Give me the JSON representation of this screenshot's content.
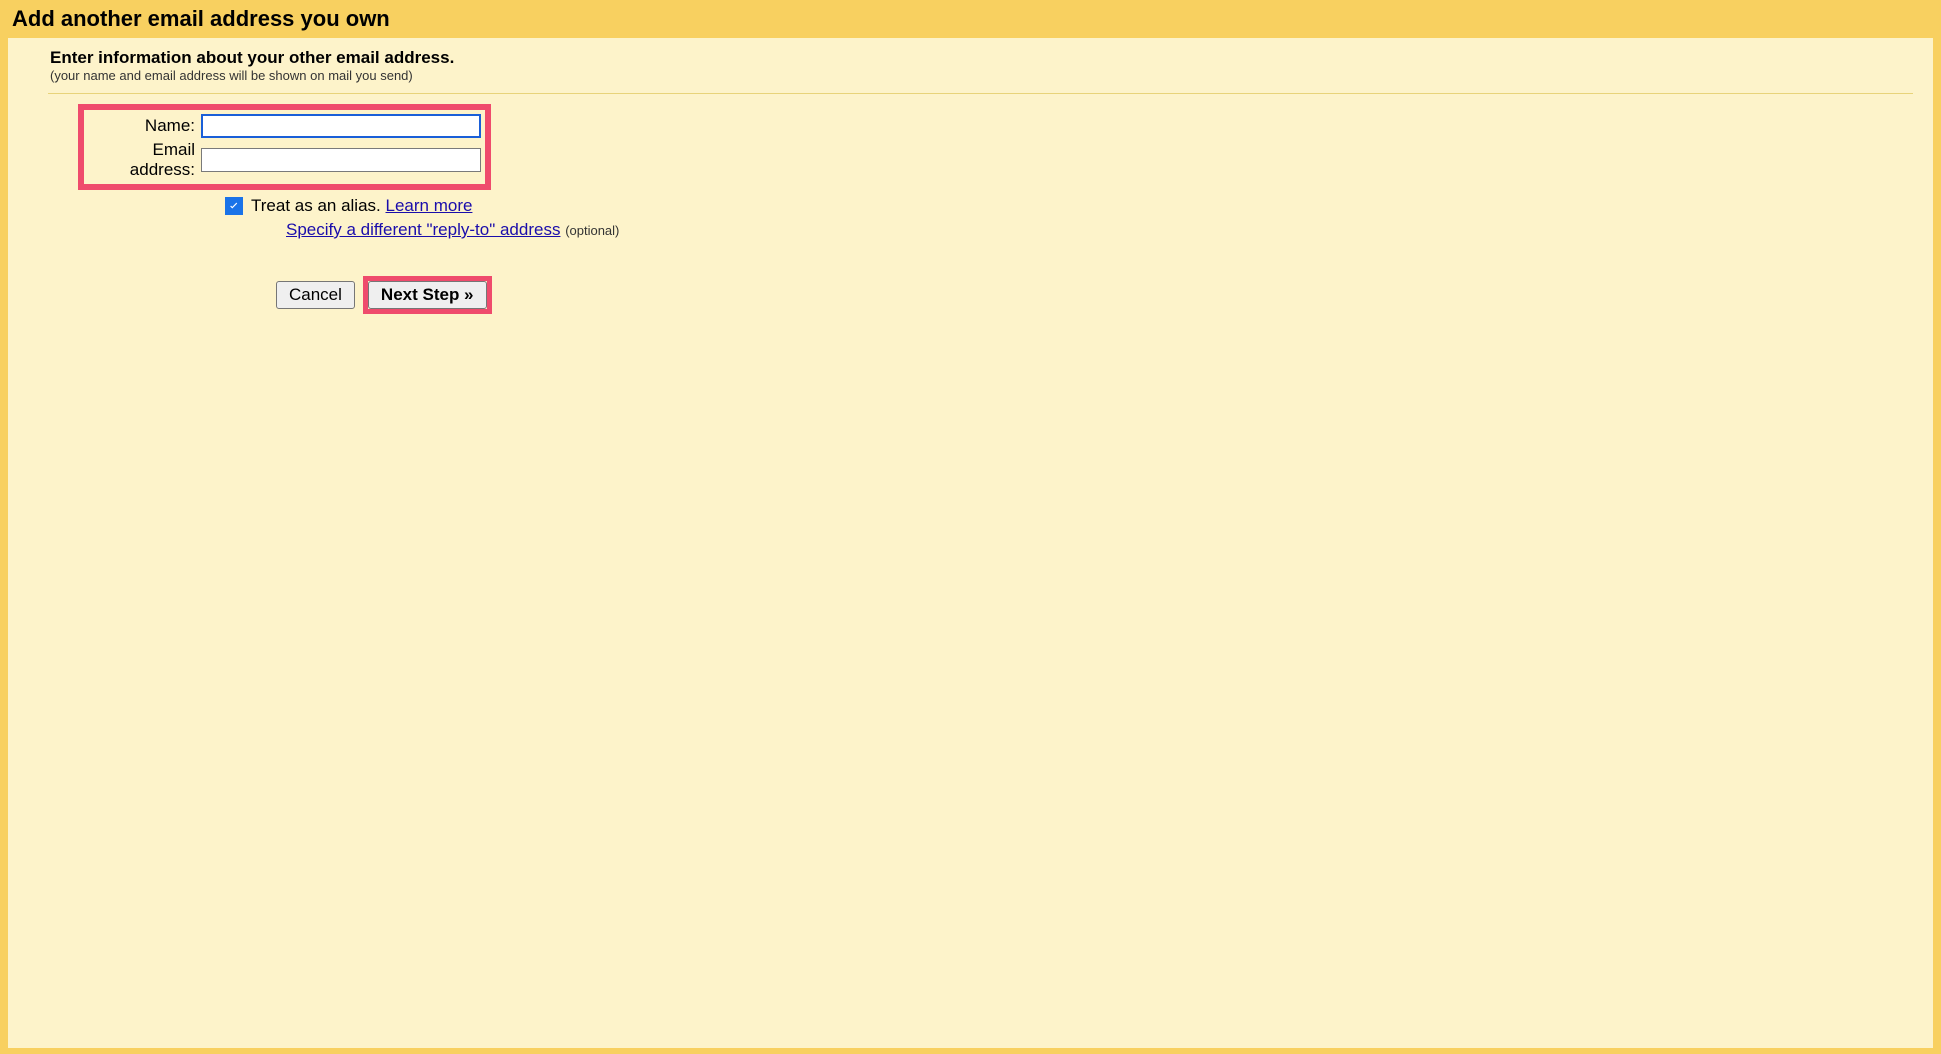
{
  "header": {
    "title": "Add another email address you own"
  },
  "intro": {
    "title": "Enter information about your other email address.",
    "sub": "(your name and email address will be shown on mail you send)"
  },
  "form": {
    "name_label": "Name:",
    "name_value": "",
    "email_label": "Email address:",
    "email_value": "",
    "alias_text": "Treat as an alias. ",
    "learn_more": "Learn more",
    "reply_to_link": "Specify a different \"reply-to\" address",
    "optional": "(optional)"
  },
  "buttons": {
    "cancel": "Cancel",
    "next": "Next Step »"
  }
}
